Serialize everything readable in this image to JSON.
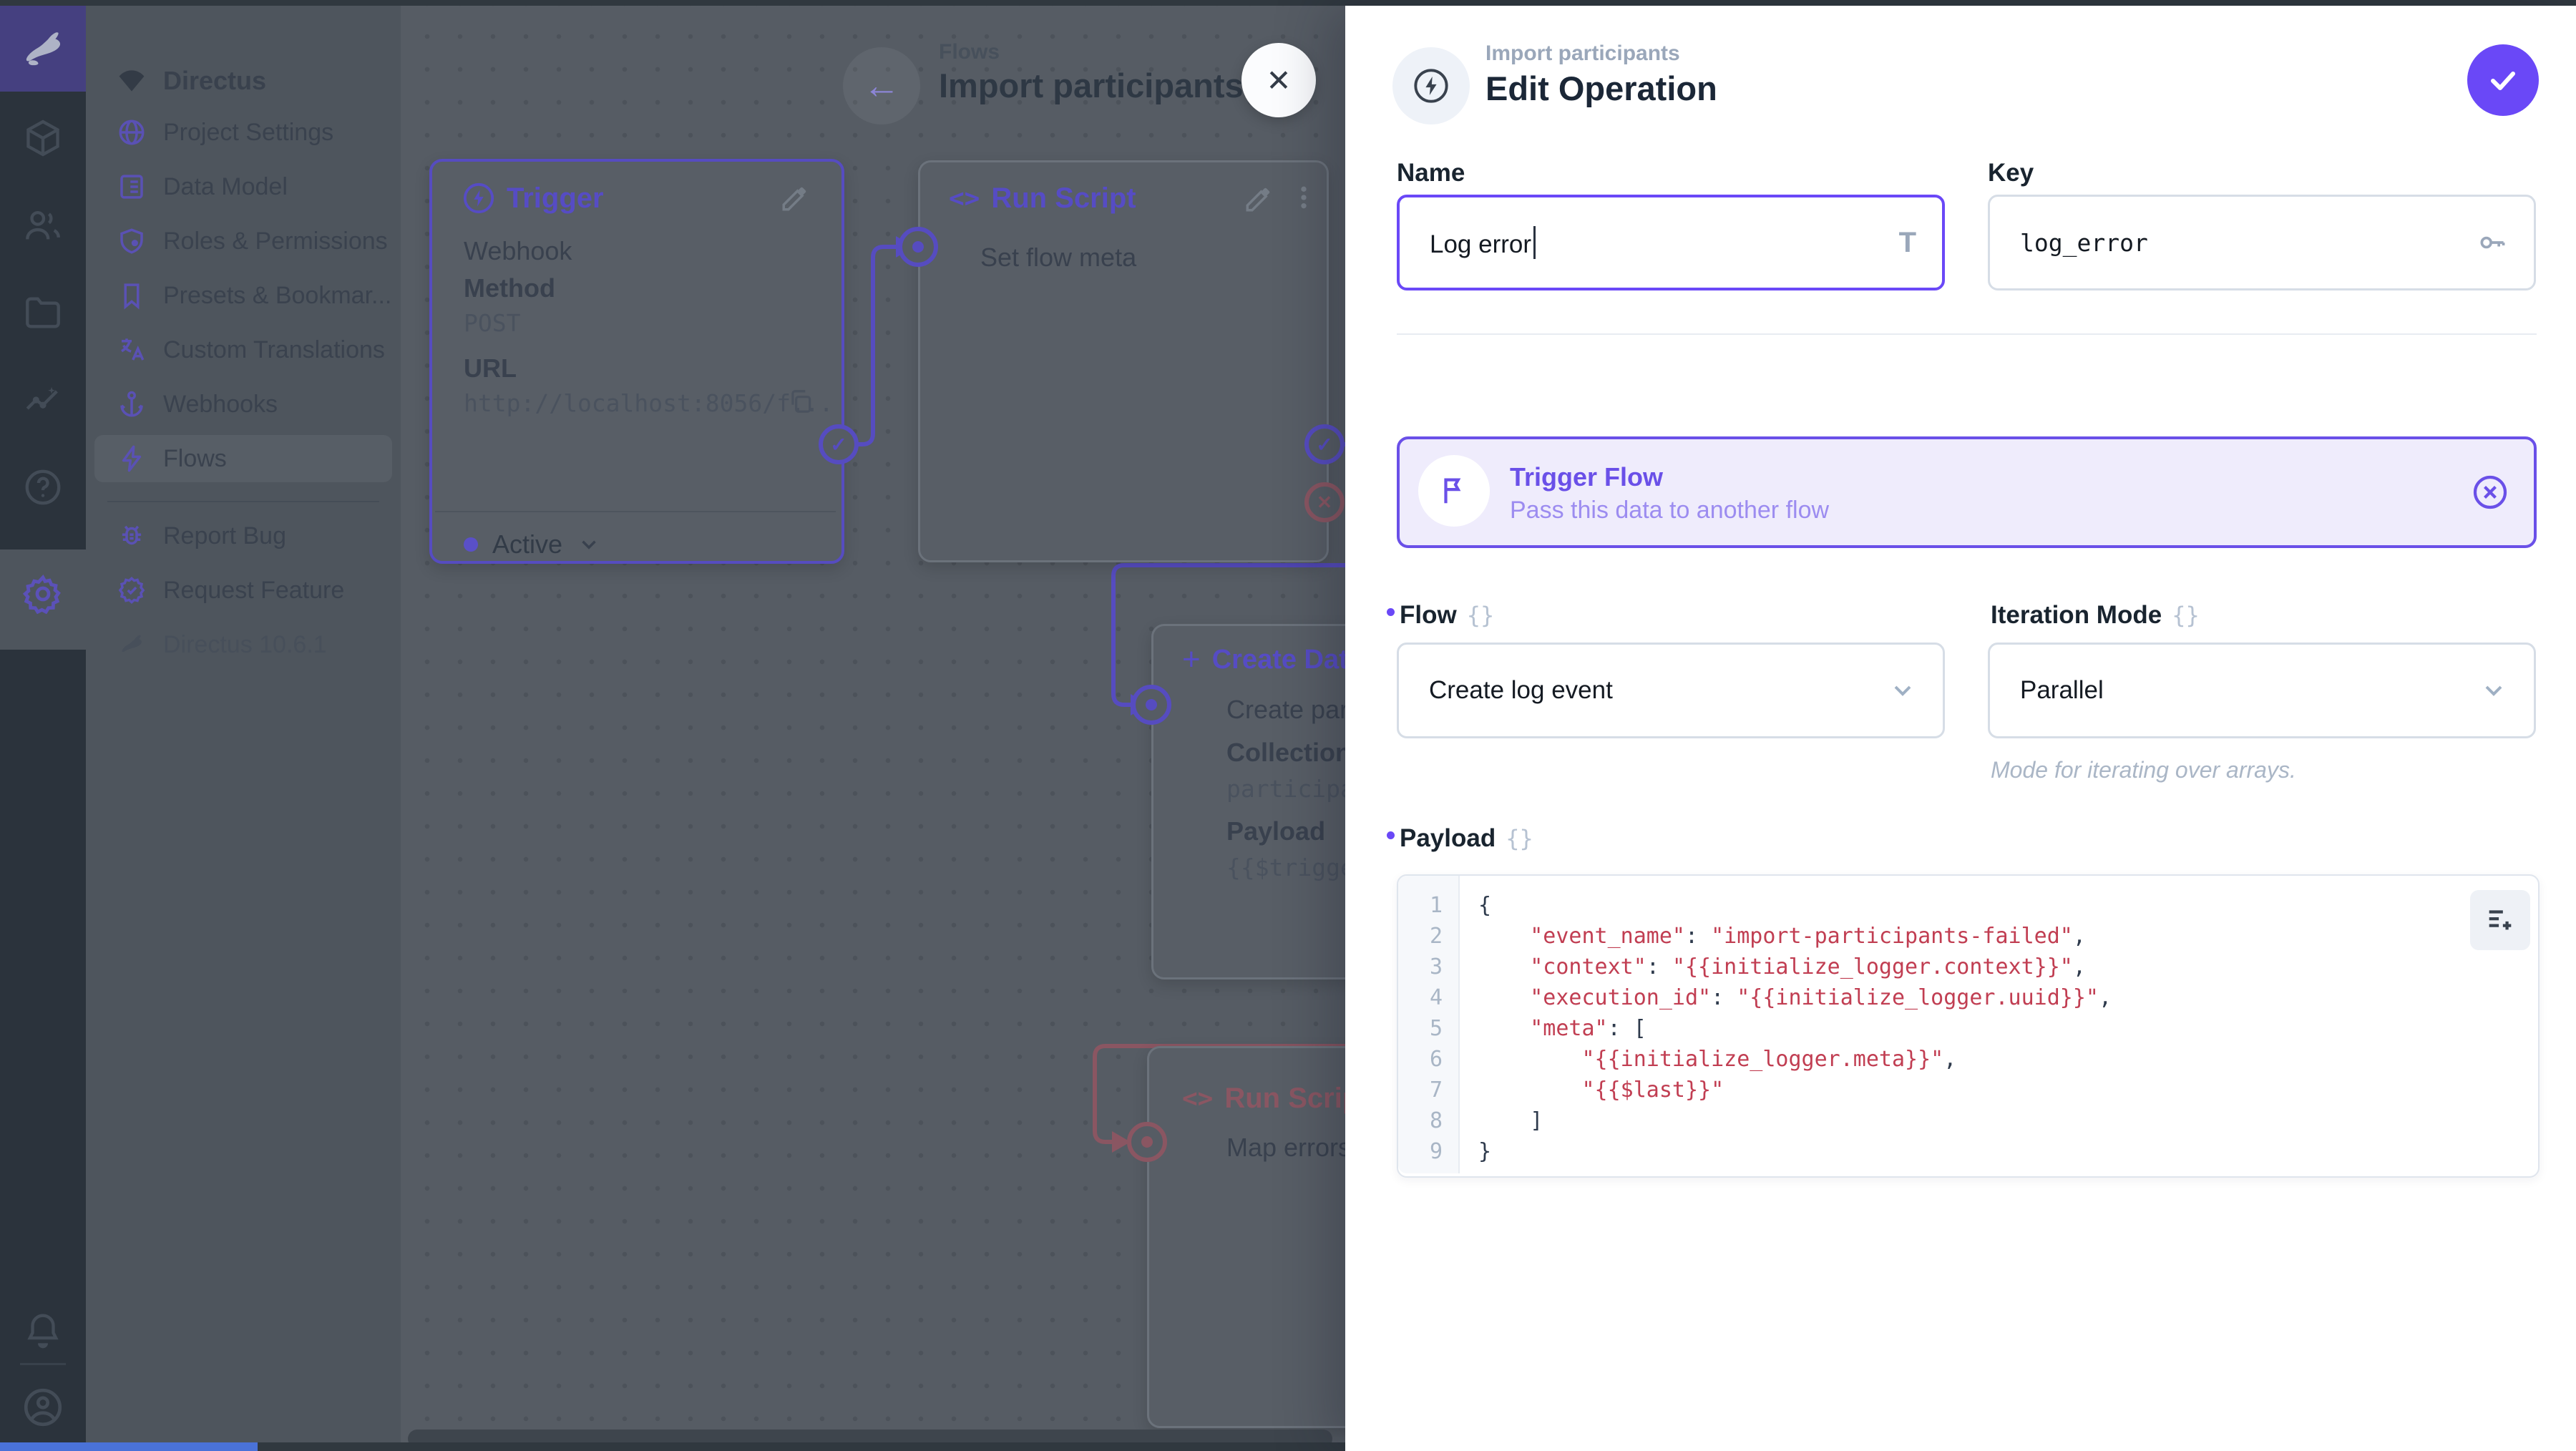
{
  "colors": {
    "accent": "#6644FF",
    "accent_dim": "#564cc0",
    "error_dim": "#8a5662",
    "drawer_bg": "#ffffff",
    "canvas_bg": "#565c64",
    "module_bg": "#2b333c",
    "logo_bg": "#454080",
    "card_bg": "#efecfc",
    "card_border": "#6a50e8",
    "code_string": "#c13e52",
    "top_strip": "#d6cdf0"
  },
  "module_bar": {
    "icons": [
      "cube-icon",
      "people-icon",
      "folder-icon",
      "activity-icon",
      "help-icon",
      "gear-icon",
      "bell-icon",
      "user-icon"
    ]
  },
  "sidebar": {
    "project_name": "Directus",
    "items": [
      {
        "label": "Project Settings",
        "icon": "globe"
      },
      {
        "label": "Data Model",
        "icon": "list"
      },
      {
        "label": "Roles & Permissions",
        "icon": "shield-user"
      },
      {
        "label": "Presets & Bookmar...",
        "icon": "bookmark"
      },
      {
        "label": "Custom Translations",
        "icon": "translate"
      },
      {
        "label": "Webhooks",
        "icon": "anchor"
      },
      {
        "label": "Flows",
        "icon": "bolt",
        "active": true
      }
    ],
    "footer_items": [
      {
        "label": "Report Bug",
        "icon": "bug"
      },
      {
        "label": "Request Feature",
        "icon": "badge-check"
      }
    ],
    "version": "Directus 10.6.1"
  },
  "canvas": {
    "breadcrumb": "Flows",
    "title": "Import participants",
    "trigger_panel": {
      "title": "Trigger",
      "type": "Webhook",
      "method_label": "Method",
      "method": "POST",
      "url_label": "URL",
      "url": "http://localhost:8056/f...",
      "status": "Active"
    },
    "run_script_panel": {
      "title": "Run Script",
      "label": "Set flow meta"
    },
    "create_data_panel": {
      "title": "Create Data",
      "label": "Create participan",
      "collection_label": "Collection",
      "collection": "participants",
      "payload_label": "Payload",
      "payload_preview": "{{$trigger.bod"
    },
    "map_errors_panel": {
      "title": "Run Script",
      "label": "Map errors"
    }
  },
  "drawer": {
    "breadcrumb": "Import participants",
    "title": "Edit Operation",
    "name_label": "Name",
    "name_value": "Log error",
    "key_label": "Key",
    "key_value": "log_error",
    "card": {
      "title": "Trigger Flow",
      "subtitle": "Pass this data to another flow"
    },
    "flow_label": "Flow",
    "flow_value": "Create log event",
    "iteration_label": "Iteration Mode",
    "iteration_value": "Parallel",
    "iteration_note": "Mode for iterating over arrays.",
    "payload_label": "Payload",
    "interface_glyph": "{}",
    "payload": {
      "lines": [
        [
          {
            "t": "{",
            "c": "p"
          }
        ],
        [
          {
            "t": "    ",
            "c": "p"
          },
          {
            "t": "\"event_name\"",
            "c": "s"
          },
          {
            "t": ": ",
            "c": "p"
          },
          {
            "t": "\"import-participants-failed\"",
            "c": "s"
          },
          {
            "t": ",",
            "c": "p"
          }
        ],
        [
          {
            "t": "    ",
            "c": "p"
          },
          {
            "t": "\"context\"",
            "c": "s"
          },
          {
            "t": ": ",
            "c": "p"
          },
          {
            "t": "\"{{initialize_logger.context}}\"",
            "c": "s"
          },
          {
            "t": ",",
            "c": "p"
          }
        ],
        [
          {
            "t": "    ",
            "c": "p"
          },
          {
            "t": "\"execution_id\"",
            "c": "s"
          },
          {
            "t": ": ",
            "c": "p"
          },
          {
            "t": "\"{{initialize_logger.uuid}}\"",
            "c": "s"
          },
          {
            "t": ",",
            "c": "p"
          }
        ],
        [
          {
            "t": "    ",
            "c": "p"
          },
          {
            "t": "\"meta\"",
            "c": "s"
          },
          {
            "t": ": [",
            "c": "p"
          }
        ],
        [
          {
            "t": "        ",
            "c": "p"
          },
          {
            "t": "\"{{initialize_logger.meta}}\"",
            "c": "s"
          },
          {
            "t": ",",
            "c": "p"
          }
        ],
        [
          {
            "t": "        ",
            "c": "p"
          },
          {
            "t": "\"{{$last}}\"",
            "c": "s"
          }
        ],
        [
          {
            "t": "    ]",
            "c": "p"
          }
        ],
        [
          {
            "t": "}",
            "c": "p"
          }
        ]
      ]
    }
  }
}
